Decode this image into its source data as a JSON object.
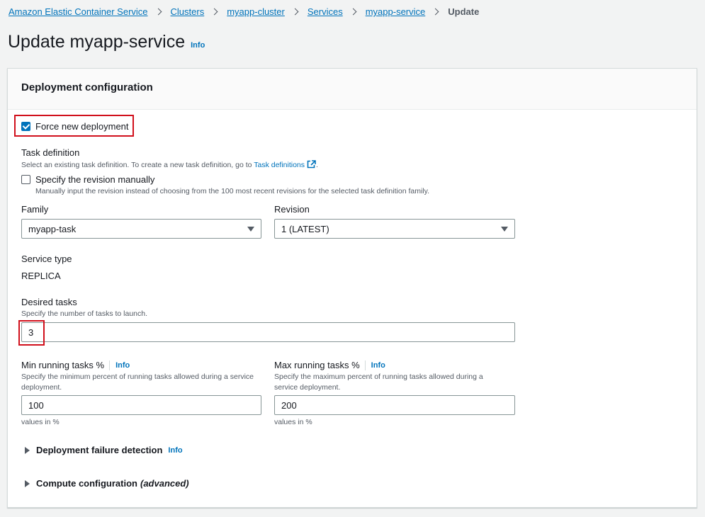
{
  "breadcrumb": {
    "items": [
      "Amazon Elastic Container Service",
      "Clusters",
      "myapp-cluster",
      "Services",
      "myapp-service"
    ],
    "current": "Update"
  },
  "page": {
    "title": "Update myapp-service",
    "info": "Info"
  },
  "panel": {
    "title": "Deployment configuration"
  },
  "force_deployment": {
    "label": "Force new deployment",
    "checked": true
  },
  "task_definition": {
    "label": "Task definition",
    "desc_prefix": "Select an existing task definition. To create a new task definition, go to ",
    "link": "Task definitions",
    "desc_suffix": ".",
    "manual_label": "Specify the revision manually",
    "manual_desc": "Manually input the revision instead of choosing from the 100 most recent revisions for the selected task definition family.",
    "manual_checked": false
  },
  "family": {
    "label": "Family",
    "value": "myapp-task"
  },
  "revision": {
    "label": "Revision",
    "value": "1 (LATEST)"
  },
  "service_type": {
    "label": "Service type",
    "value": "REPLICA"
  },
  "desired_tasks": {
    "label": "Desired tasks",
    "desc": "Specify the number of tasks to launch.",
    "value": "3"
  },
  "min_running": {
    "label": "Min running tasks %",
    "info": "Info",
    "desc": "Specify the minimum percent of running tasks allowed during a service deployment.",
    "value": "100",
    "hint": "values in %"
  },
  "max_running": {
    "label": "Max running tasks %",
    "info": "Info",
    "desc": "Specify the maximum percent of running tasks allowed during a service deployment.",
    "value": "200",
    "hint": "values in %"
  },
  "expanders": {
    "failure_detection": "Deployment failure detection",
    "failure_info": "Info",
    "compute_config": "Compute configuration",
    "compute_suffix": "(advanced)"
  },
  "colors": {
    "link": "#0073bb",
    "highlight": "#d1101c",
    "checkbox_checked": "#0073bb"
  }
}
